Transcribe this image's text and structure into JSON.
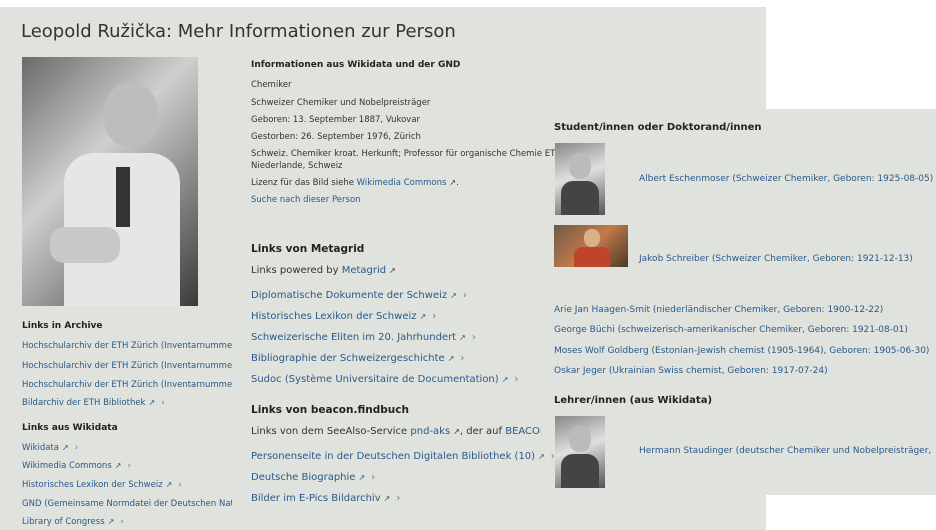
{
  "page": {
    "title": "Leopold Ružička: Mehr Informationen zur Person"
  },
  "archive": {
    "heading": "Links in Archive",
    "items": [
      "Hochschularchiv der ETH Zürich (Inventarnummer:",
      "Hochschularchiv der ETH Zürich (Inventarnummer:",
      "Hochschularchiv der ETH Zürich (Inventarnummer:",
      "Bildarchiv der ETH Bibliothek"
    ]
  },
  "wikidata_links": {
    "heading": "Links aus Wikidata",
    "items": [
      "Wikidata",
      "Wikimedia Commons",
      "Historisches Lexikon der Schweiz",
      "GND (Gemeinsame Normdatei der Deutschen Natio",
      "Library of Congress"
    ]
  },
  "info": {
    "heading": "Informationen aus Wikidata und der GND",
    "lines": [
      "Chemiker",
      "Schweizer Chemiker und Nobelpreisträger",
      "Geboren: 13. September 1887, Vukovar",
      "Gestorben: 26. September 1976, Zürich",
      "Schweiz. Chemiker kroat. Herkunft; Professor für organische Chemie ET",
      "Niederlande, Schweiz"
    ],
    "license_prefix": "Lizenz für das Bild siehe",
    "license_link": "Wikimedia Commons",
    "license_suffix": ".",
    "search_link": "Suche nach dieser Person"
  },
  "metagrid": {
    "heading": "Links von Metagrid",
    "powered_prefix": "Links powered by",
    "powered_link": "Metagrid",
    "items": [
      "Diplomatische Dokumente der Schweiz",
      "Historisches Lexikon der Schweiz",
      "Schweizerische Eliten im 20. Jahrhundert",
      "Bibliographie der Schweizergeschichte",
      "Sudoc (Système Universitaire de Documentation)"
    ]
  },
  "beacon": {
    "heading": "Links von beacon.findbuch",
    "intro_prefix": "Links von dem SeeAlso-Service",
    "intro_link1": "pnd-aks",
    "intro_mid": ", der auf",
    "intro_link2": "BEACON",
    "items": [
      "Personenseite in der Deutschen Digitalen Bibliothek (10)",
      "Deutsche Biographie",
      "Bilder im E-Pics Bildarchiv"
    ]
  },
  "students": {
    "heading": "Student/innen oder Doktorand/innen",
    "with_photo": [
      "Albert Eschenmoser (Schweizer Chemiker, Geboren: 1925-08-05)",
      "Jakob Schreiber (Schweizer Chemiker, Geboren: 1921-12-13)"
    ],
    "list": [
      "Arie Jan Haagen-Smit (niederländischer Chemiker, Geboren: 1900-12-22)",
      "George Büchi (schweizerisch-amerikanischer Chemiker, Geboren: 1921-08-01)",
      "Moses Wolf Goldberg (Estonian-Jewish chemist (1905-1964), Geboren: 1905-06-30)",
      "Oskar Jeger (Ukrainian Swiss chemist, Geboren: 1917-07-24)"
    ]
  },
  "teachers": {
    "heading": "Lehrer/innen (aus Wikidata)",
    "items": [
      "Hermann Staudinger (deutscher Chemiker und Nobelpreisträger,"
    ]
  },
  "icons": {
    "external": "↗",
    "chevron": "›"
  }
}
